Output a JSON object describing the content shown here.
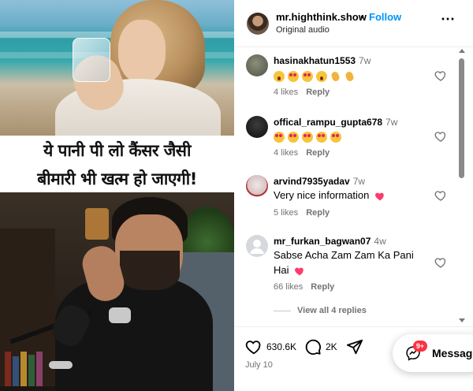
{
  "post": {
    "username": "mr.highthink.show",
    "separator": "•",
    "follow_label": "Follow",
    "audio_label": "Original audio",
    "more_label": "⋯"
  },
  "media": {
    "caption_line_1": "ये पानी पी लो कैंसर जैसी",
    "caption_line_2": "बीमारी भी खत्म हो जाएगी!"
  },
  "comments": [
    {
      "username": "hasinakhatun1553",
      "time": "7w",
      "emojis": [
        "wow",
        "heart-eyes",
        "heart-eyes",
        "wow",
        "clap",
        "clap"
      ],
      "likes": "4 likes",
      "reply": "Reply"
    },
    {
      "username": "offical_rampu_gupta678",
      "time": "7w",
      "emojis": [
        "heart-eyes",
        "heart-eyes",
        "heart-eyes",
        "heart-eyes",
        "heart-eyes"
      ],
      "likes": "4 likes",
      "reply": "Reply"
    },
    {
      "username": "arvind7935yadav",
      "time": "7w",
      "text": "Very nice information",
      "text_emoji": "heart",
      "likes": "5 likes",
      "reply": "Reply"
    },
    {
      "username": "mr_furkan_bagwan07",
      "time": "4w",
      "text": "Sabse Acha Zam Zam Ka Pani",
      "text_line2": "Hai",
      "text_emoji": "heart",
      "likes": "66 likes",
      "reply": "Reply",
      "view_replies": "View all 4 replies"
    }
  ],
  "actions": {
    "like_count": "630.6K",
    "comment_count": "2K",
    "date": "July 10"
  },
  "messages": {
    "label": "Messages",
    "badge": "9+"
  },
  "colors": {
    "follow": "#0095f6",
    "heart_red": "#ff3040",
    "badge": "#ff3040",
    "muted": "#737373"
  }
}
